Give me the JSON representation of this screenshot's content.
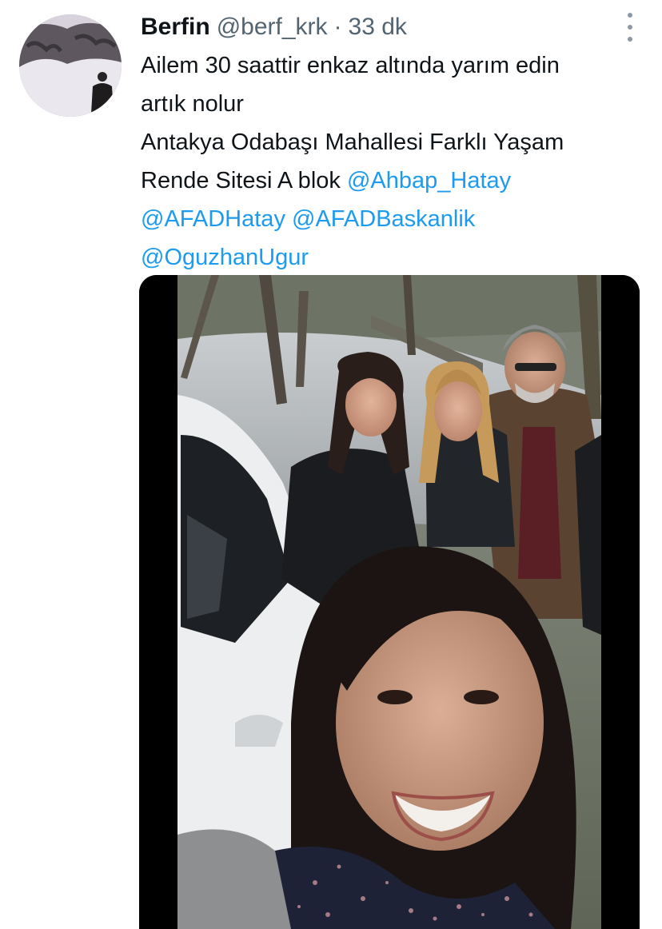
{
  "tweet": {
    "author_name": "Berfin",
    "handle": "@berf_krk",
    "separator": "·",
    "time": "33 dk",
    "text_line_1": "Ailem 30 saattir enkaz altında yarım edin",
    "text_line_2": "artık nolur",
    "text_line_3": "Antakya Odabaşı Mahallesi Farklı Yaşam",
    "text_line_4_plain": "Rende Sitesi A blok",
    "mentions": [
      "@Ahbap_Hatay",
      "@AFADHatay",
      "@AFADBaskanlik",
      "@OguzhanUgur"
    ]
  },
  "icons": {
    "more": "more-vertical-icon"
  }
}
